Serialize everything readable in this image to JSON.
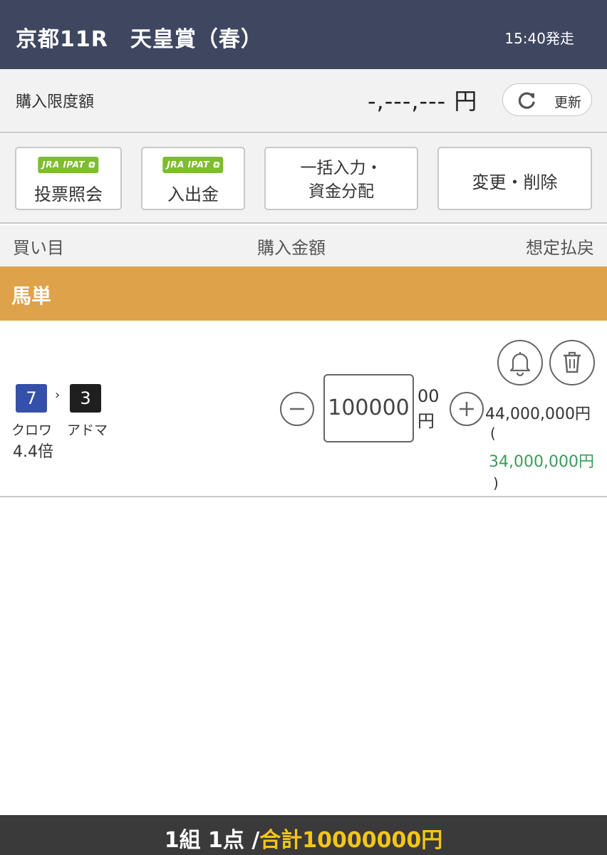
{
  "header": {
    "title": "京都11R　天皇賞（春）",
    "post_time": "15:40発走"
  },
  "purchase_limit": {
    "label": "購入限度額",
    "amount": "-,---,--- 円",
    "refresh_label": "更新",
    "refresh_icon": "refresh-icon"
  },
  "toolbar": {
    "vote_inquiry": {
      "badge": "JRA IPAT",
      "label": "投票照会"
    },
    "deposit": {
      "badge": "JRA IPAT",
      "label": "入出金"
    },
    "bulk_input": {
      "line1": "一括入力・",
      "line2": "資金分配"
    },
    "change_delete": {
      "label": "変更・削除"
    }
  },
  "columns": {
    "bet": "買い目",
    "amount": "購入金額",
    "payout": "想定払戻"
  },
  "section": {
    "title": "馬単"
  },
  "bet": {
    "horse1": {
      "number": "7",
      "name": "クロワ",
      "color": "#3550a8"
    },
    "arrow": "›",
    "horse2": {
      "number": "3",
      "name": "アドマ",
      "color": "#1f1f1f"
    },
    "odds": "4.4倍",
    "amount_value": "100000",
    "unit_line1": "00",
    "unit_line2": "円",
    "payout": "44,000,000円",
    "paren_open": "(",
    "profit": "34,000,000円",
    "paren_close": ")"
  },
  "footer": {
    "summary": "1組 1点 /",
    "total": "合計10000000円"
  },
  "colors": {
    "header_bg": "#3e4660",
    "section_bg": "#dea24a",
    "badge_green": "#7dbd2f",
    "profit_green": "#3a9c5a",
    "total_yellow": "#f5c518"
  }
}
